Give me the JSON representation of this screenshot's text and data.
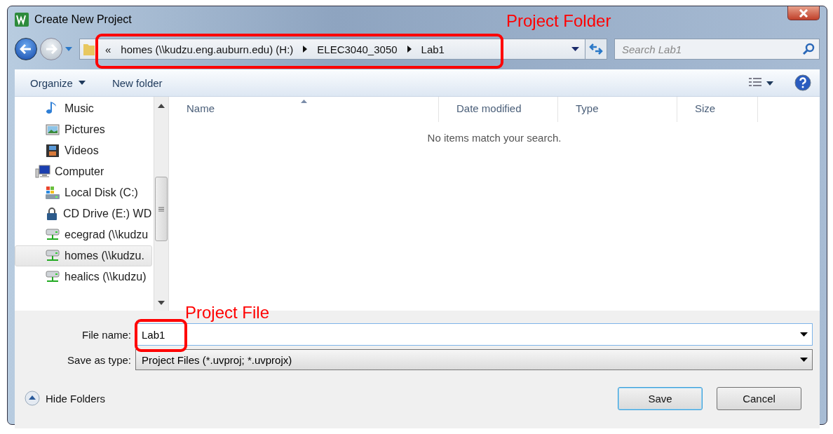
{
  "window": {
    "title": "Create New Project"
  },
  "address": {
    "overflow": "«",
    "crumbs": [
      "homes (\\\\kudzu.eng.auburn.edu) (H:)",
      "ELEC3040_3050",
      "Lab1"
    ]
  },
  "search": {
    "placeholder": "Search Lab1"
  },
  "toolbar": {
    "organize": "Organize",
    "new_folder": "New folder"
  },
  "nav": [
    {
      "label": "Music",
      "kind": "music",
      "selected": false
    },
    {
      "label": "Pictures",
      "kind": "pictures",
      "selected": false
    },
    {
      "label": "Videos",
      "kind": "videos",
      "selected": false
    },
    {
      "label": "Computer",
      "kind": "computer",
      "selected": false,
      "children": [
        {
          "label": "Local Disk (C:)",
          "kind": "disk",
          "selected": false
        },
        {
          "label": "CD Drive (E:) WD",
          "kind": "cd",
          "selected": false
        },
        {
          "label": "ecegrad (\\\\kudzu",
          "kind": "network",
          "selected": false
        },
        {
          "label": "homes (\\\\kudzu.",
          "kind": "network",
          "selected": true
        },
        {
          "label": "healics (\\\\kudzu)",
          "kind": "network",
          "selected": false
        }
      ]
    }
  ],
  "columns": [
    {
      "label": "Name",
      "sorted": true
    },
    {
      "label": "Date modified",
      "sorted": false
    },
    {
      "label": "Type",
      "sorted": false
    },
    {
      "label": "Size",
      "sorted": false
    }
  ],
  "empty_message": "No items match your search.",
  "file_name": {
    "label": "File name:",
    "value": "Lab1"
  },
  "save_as_type": {
    "label": "Save as type:",
    "value": "Project Files (*.uvproj; *.uvprojx)"
  },
  "hide_folders": "Hide Folders",
  "buttons": [
    {
      "label": "Save",
      "default": true
    },
    {
      "label": "Cancel",
      "default": false
    }
  ],
  "annotations": [
    {
      "label": "Project Folder"
    },
    {
      "label": "Project File"
    }
  ]
}
